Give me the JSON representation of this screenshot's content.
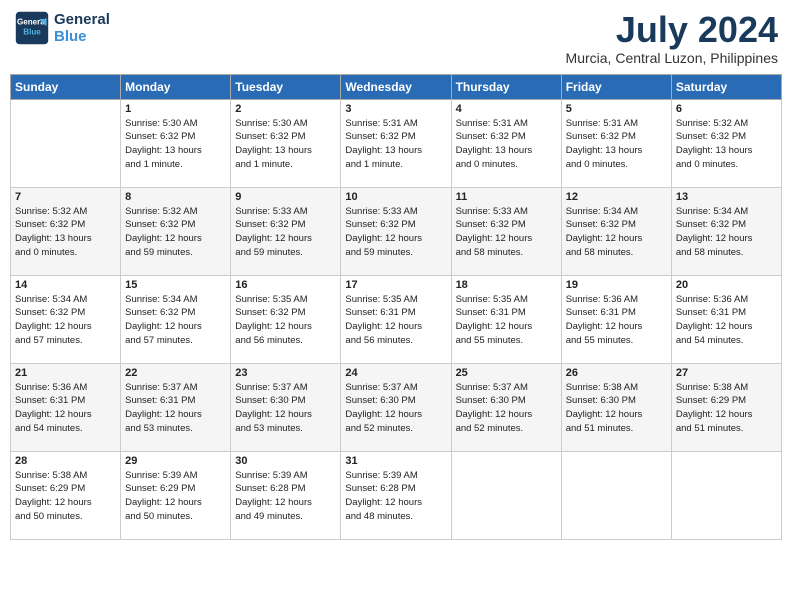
{
  "header": {
    "logo_line1": "General",
    "logo_line2": "Blue",
    "month": "July 2024",
    "location": "Murcia, Central Luzon, Philippines"
  },
  "days_of_week": [
    "Sunday",
    "Monday",
    "Tuesday",
    "Wednesday",
    "Thursday",
    "Friday",
    "Saturday"
  ],
  "weeks": [
    [
      {
        "day": "",
        "info": ""
      },
      {
        "day": "1",
        "info": "Sunrise: 5:30 AM\nSunset: 6:32 PM\nDaylight: 13 hours\nand 1 minute."
      },
      {
        "day": "2",
        "info": "Sunrise: 5:30 AM\nSunset: 6:32 PM\nDaylight: 13 hours\nand 1 minute."
      },
      {
        "day": "3",
        "info": "Sunrise: 5:31 AM\nSunset: 6:32 PM\nDaylight: 13 hours\nand 1 minute."
      },
      {
        "day": "4",
        "info": "Sunrise: 5:31 AM\nSunset: 6:32 PM\nDaylight: 13 hours\nand 0 minutes."
      },
      {
        "day": "5",
        "info": "Sunrise: 5:31 AM\nSunset: 6:32 PM\nDaylight: 13 hours\nand 0 minutes."
      },
      {
        "day": "6",
        "info": "Sunrise: 5:32 AM\nSunset: 6:32 PM\nDaylight: 13 hours\nand 0 minutes."
      }
    ],
    [
      {
        "day": "7",
        "info": "Sunrise: 5:32 AM\nSunset: 6:32 PM\nDaylight: 13 hours\nand 0 minutes."
      },
      {
        "day": "8",
        "info": "Sunrise: 5:32 AM\nSunset: 6:32 PM\nDaylight: 12 hours\nand 59 minutes."
      },
      {
        "day": "9",
        "info": "Sunrise: 5:33 AM\nSunset: 6:32 PM\nDaylight: 12 hours\nand 59 minutes."
      },
      {
        "day": "10",
        "info": "Sunrise: 5:33 AM\nSunset: 6:32 PM\nDaylight: 12 hours\nand 59 minutes."
      },
      {
        "day": "11",
        "info": "Sunrise: 5:33 AM\nSunset: 6:32 PM\nDaylight: 12 hours\nand 58 minutes."
      },
      {
        "day": "12",
        "info": "Sunrise: 5:34 AM\nSunset: 6:32 PM\nDaylight: 12 hours\nand 58 minutes."
      },
      {
        "day": "13",
        "info": "Sunrise: 5:34 AM\nSunset: 6:32 PM\nDaylight: 12 hours\nand 58 minutes."
      }
    ],
    [
      {
        "day": "14",
        "info": "Sunrise: 5:34 AM\nSunset: 6:32 PM\nDaylight: 12 hours\nand 57 minutes."
      },
      {
        "day": "15",
        "info": "Sunrise: 5:34 AM\nSunset: 6:32 PM\nDaylight: 12 hours\nand 57 minutes."
      },
      {
        "day": "16",
        "info": "Sunrise: 5:35 AM\nSunset: 6:32 PM\nDaylight: 12 hours\nand 56 minutes."
      },
      {
        "day": "17",
        "info": "Sunrise: 5:35 AM\nSunset: 6:31 PM\nDaylight: 12 hours\nand 56 minutes."
      },
      {
        "day": "18",
        "info": "Sunrise: 5:35 AM\nSunset: 6:31 PM\nDaylight: 12 hours\nand 55 minutes."
      },
      {
        "day": "19",
        "info": "Sunrise: 5:36 AM\nSunset: 6:31 PM\nDaylight: 12 hours\nand 55 minutes."
      },
      {
        "day": "20",
        "info": "Sunrise: 5:36 AM\nSunset: 6:31 PM\nDaylight: 12 hours\nand 54 minutes."
      }
    ],
    [
      {
        "day": "21",
        "info": "Sunrise: 5:36 AM\nSunset: 6:31 PM\nDaylight: 12 hours\nand 54 minutes."
      },
      {
        "day": "22",
        "info": "Sunrise: 5:37 AM\nSunset: 6:31 PM\nDaylight: 12 hours\nand 53 minutes."
      },
      {
        "day": "23",
        "info": "Sunrise: 5:37 AM\nSunset: 6:30 PM\nDaylight: 12 hours\nand 53 minutes."
      },
      {
        "day": "24",
        "info": "Sunrise: 5:37 AM\nSunset: 6:30 PM\nDaylight: 12 hours\nand 52 minutes."
      },
      {
        "day": "25",
        "info": "Sunrise: 5:37 AM\nSunset: 6:30 PM\nDaylight: 12 hours\nand 52 minutes."
      },
      {
        "day": "26",
        "info": "Sunrise: 5:38 AM\nSunset: 6:30 PM\nDaylight: 12 hours\nand 51 minutes."
      },
      {
        "day": "27",
        "info": "Sunrise: 5:38 AM\nSunset: 6:29 PM\nDaylight: 12 hours\nand 51 minutes."
      }
    ],
    [
      {
        "day": "28",
        "info": "Sunrise: 5:38 AM\nSunset: 6:29 PM\nDaylight: 12 hours\nand 50 minutes."
      },
      {
        "day": "29",
        "info": "Sunrise: 5:39 AM\nSunset: 6:29 PM\nDaylight: 12 hours\nand 50 minutes."
      },
      {
        "day": "30",
        "info": "Sunrise: 5:39 AM\nSunset: 6:28 PM\nDaylight: 12 hours\nand 49 minutes."
      },
      {
        "day": "31",
        "info": "Sunrise: 5:39 AM\nSunset: 6:28 PM\nDaylight: 12 hours\nand 48 minutes."
      },
      {
        "day": "",
        "info": ""
      },
      {
        "day": "",
        "info": ""
      },
      {
        "day": "",
        "info": ""
      }
    ]
  ]
}
